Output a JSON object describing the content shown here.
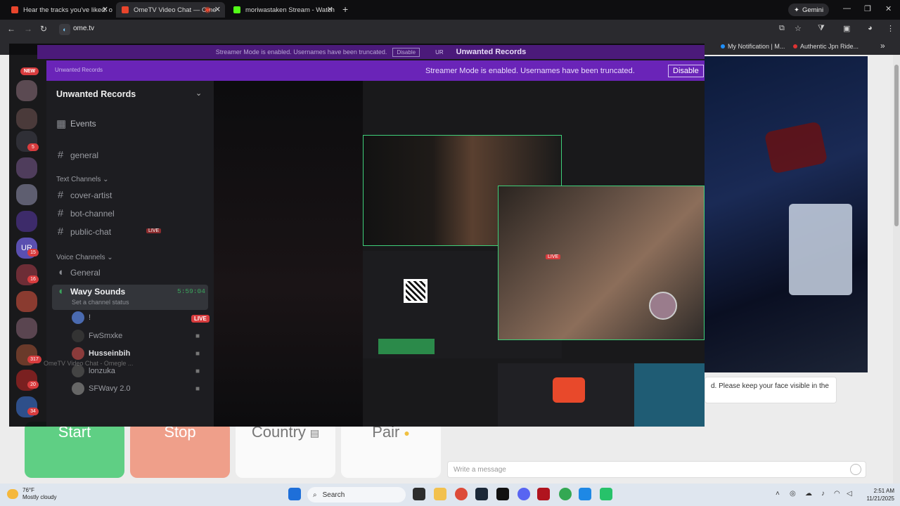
{
  "browser": {
    "tabs": [
      {
        "title": "Hear the tracks you've liked: or",
        "color": "#e8452c"
      },
      {
        "title": "OmeTV Video Chat — Ome",
        "color": "#e8452c"
      },
      {
        "title": "moriwastaken Stream - Watch",
        "color": "#53fc18"
      }
    ],
    "gemini_label": "Gemini",
    "url": "ome.tv",
    "bookmarks": [
      "My Notification | M...",
      "Authentic Jpn Ride..."
    ],
    "bookmarks_more": "»"
  },
  "discord": {
    "streamer_banner_small": "Streamer Mode is enabled. Usernames have been truncated.",
    "disable_small": "Disable",
    "ur_tag": "UR",
    "server_name_banner": "Unwanted Records",
    "streamer_banner": "Streamer Mode is enabled. Usernames have been truncated.",
    "disable": "Disable",
    "server_name_small": "Unwanted Records",
    "server_name": "Unwanted Records",
    "new_badge": "NEW",
    "server_badges": [
      "5",
      "15",
      "16",
      "317",
      "20",
      "34"
    ],
    "events": "Events",
    "channel_general": "general",
    "category_text": "Text Channels",
    "channel_cover_artist": "cover-artist",
    "channel_bot": "bot-channel",
    "channel_public_chat": "public-chat",
    "live_small": "LIVE",
    "category_voice": "Voice Channels",
    "voice_general": "General",
    "voice_wavy": "Wavy Sounds",
    "voice_timer": "5:59:04",
    "set_status": "Set a channel status",
    "live": "LIVE",
    "voice_user_1": "!",
    "voice_user_2": "FwSmxke",
    "voice_user_3": "Husseinbih",
    "voice_user_4": "lonzuka",
    "voice_user_5": "SFWavy 2.0",
    "overlay_ghost": "OmeTV Video Chat - Omegle ..."
  },
  "ometv": {
    "notice": "d. Please keep your face visible in the",
    "start": "Start",
    "stop": "Stop",
    "country": "Country",
    "pair": "Pair",
    "message_placeholder": "Write a message"
  },
  "taskbar": {
    "temp": "76°F",
    "weather": "Mostly cloudy",
    "search": "Search",
    "time": "2:51 AM",
    "date": "11/21/2025"
  }
}
